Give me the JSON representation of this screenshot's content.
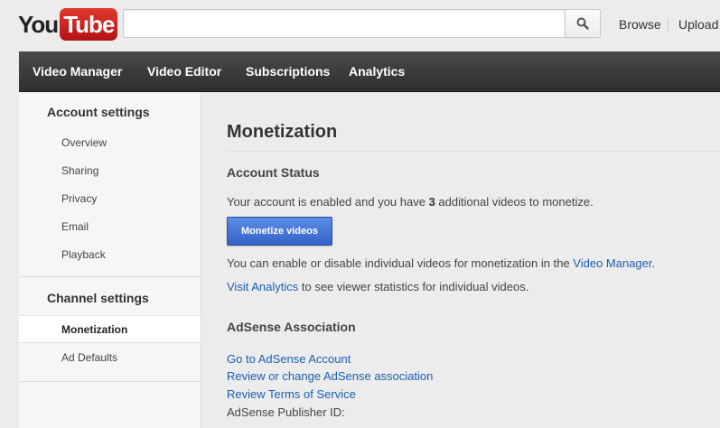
{
  "masthead": {
    "logo_you": "You",
    "logo_tube": "Tube",
    "search": {
      "value": "",
      "placeholder": ""
    },
    "links": {
      "browse": "Browse",
      "upload": "Upload"
    }
  },
  "nav": {
    "items": [
      "Video Manager",
      "Video Editor",
      "Subscriptions",
      "Analytics"
    ]
  },
  "sidebar": {
    "account_heading": "Account settings",
    "account_items": [
      "Overview",
      "Sharing",
      "Privacy",
      "Email",
      "Playback"
    ],
    "channel_heading": "Channel settings",
    "channel_items": [
      "Monetization",
      "Ad Defaults"
    ],
    "active_item": "Monetization"
  },
  "main": {
    "title": "Monetization",
    "account_status": {
      "heading": "Account Status",
      "text_before": "Your account is enabled and you have ",
      "count": "3",
      "text_after": " additional videos to monetize.",
      "button_label": "Monetize videos",
      "enable_text": "You can enable or disable individual videos for monetization in the ",
      "video_manager_link": "Video Manager",
      "enable_text_end": ".",
      "visit_analytics_link": "Visit Analytics",
      "analytics_text": " to see viewer statistics for individual videos."
    },
    "adsense": {
      "heading": "AdSense Association",
      "links": [
        "Go to AdSense Account",
        "Review or change AdSense association",
        "Review Terms of Service"
      ],
      "publisher_id_label": "AdSense Publisher ID:"
    }
  },
  "colors": {
    "accent_blue": "#3462c7",
    "link_blue": "#1a5fb4",
    "nav_dark": "#2f2f2f",
    "logo_red": "#c4181f"
  },
  "icons": {
    "search": "magnifier-icon"
  }
}
